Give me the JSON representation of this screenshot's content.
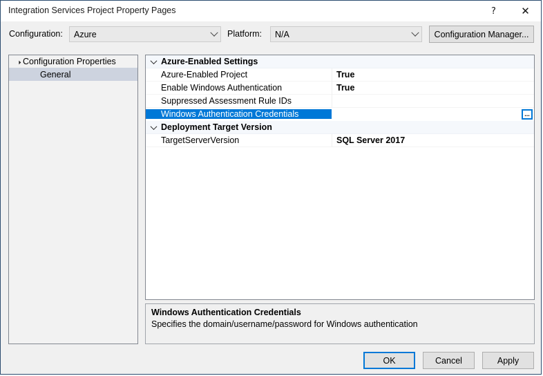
{
  "window": {
    "title": "Integration Services Project Property Pages",
    "help_glyph": "?",
    "close_glyph": "✕"
  },
  "config_row": {
    "configuration_label": "Configuration:",
    "configuration_value": "Azure",
    "platform_label": "Platform:",
    "platform_value": "N/A",
    "configuration_manager_button": "Configuration Manager..."
  },
  "tree": {
    "root_label": "Configuration Properties",
    "child_label": "General"
  },
  "grid": {
    "rows": [
      {
        "kind": "category",
        "name": "Azure-Enabled Settings",
        "value": ""
      },
      {
        "kind": "property",
        "name": "Azure-Enabled Project",
        "value": "True"
      },
      {
        "kind": "property",
        "name": "Enable Windows Authentication",
        "value": "True"
      },
      {
        "kind": "property",
        "name": "Suppressed Assessment Rule IDs",
        "value": ""
      },
      {
        "kind": "property",
        "name": "Windows Authentication Credentials",
        "value": "",
        "selected": true,
        "has_ellipsis": true
      },
      {
        "kind": "category",
        "name": "Deployment Target Version",
        "value": ""
      },
      {
        "kind": "property",
        "name": "TargetServerVersion",
        "value": "SQL Server 2017"
      }
    ],
    "ellipsis_label": "..."
  },
  "description": {
    "title": "Windows Authentication Credentials",
    "text": "Specifies the domain/username/password for Windows authentication"
  },
  "footer": {
    "ok": "OK",
    "cancel": "Cancel",
    "apply": "Apply"
  },
  "colors": {
    "accent": "#0078d7",
    "selection_tree": "#cdd3df",
    "category_bg": "#f5f8fc",
    "dialog_bg": "#f0f0f0"
  }
}
